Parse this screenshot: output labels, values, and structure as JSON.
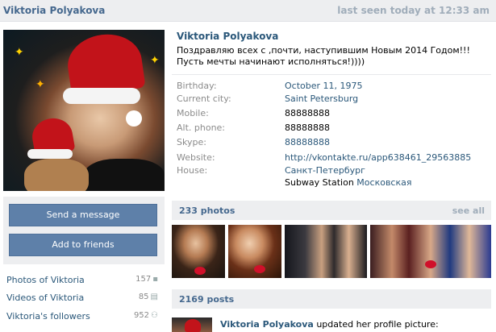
{
  "header": {
    "name": "Viktoria Polyakova",
    "last_seen": "last seen today at 12:33 am"
  },
  "profile": {
    "name": "Viktoria Polyakova",
    "status": "Поздравляю всех с ,почти, наступившим Новым 2014 Годом!!!Пусть мечты начинают исполняться!))))",
    "info": [
      {
        "label": "Birthday:",
        "value": "October 11, 1975",
        "link": true
      },
      {
        "label": "Current city:",
        "value": "Saint Petersburg",
        "link": true
      },
      {
        "label": "Mobile:",
        "value": "88888888",
        "link": false
      },
      {
        "label": "Alt. phone:",
        "value": "88888888",
        "link": false
      },
      {
        "label": "Skype:",
        "value": "88888888",
        "link": true
      },
      {
        "label": "Website:",
        "value": "http://vkontakte.ru/app638461_29563885",
        "link": true
      },
      {
        "label": "House:",
        "value": "Санкт-Петербург",
        "link": true
      }
    ],
    "subway_label": "Subway Station",
    "subway_value": "Московская"
  },
  "actions": {
    "send_message": "Send a message",
    "add_friend": "Add to friends"
  },
  "side_links": [
    {
      "label": "Photos of Viktoria",
      "count": "157",
      "icon": "camera-icon"
    },
    {
      "label": "Videos of Viktoria",
      "count": "85",
      "icon": "film-icon"
    },
    {
      "label": "Viktoria's followers",
      "count": "952",
      "icon": "people-icon"
    }
  ],
  "photos_section": {
    "title": "233 photos",
    "see_all": "see all"
  },
  "posts_section": {
    "title": "2169 posts"
  },
  "post": {
    "author": "Viktoria Polyakova",
    "action": "updated her profile picture:"
  },
  "colors": {
    "link": "#2b587a",
    "button": "#5e80a9",
    "header_bg": "#edeef0",
    "muted": "#a0adba"
  }
}
